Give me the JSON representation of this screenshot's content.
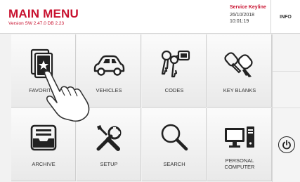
{
  "header": {
    "title": "MAIN MENU",
    "version": "Version SW 2.47.0 DB 2.23",
    "service": "Service Keyline",
    "date": "26/10/2018",
    "time": "10:01:19",
    "info_label": "INFO"
  },
  "menu": [
    {
      "label": "FAVORITES",
      "icon": "favorites-icon"
    },
    {
      "label": "VEHICLES",
      "icon": "car-icon"
    },
    {
      "label": "CODES",
      "icon": "keys-icon"
    },
    {
      "label": "KEY BLANKS",
      "icon": "key-blank-icon"
    },
    {
      "label": "ARCHIVE",
      "icon": "archive-tray-icon"
    },
    {
      "label": "SETUP",
      "icon": "tools-icon"
    },
    {
      "label": "SEARCH",
      "icon": "magnifier-icon"
    },
    {
      "label": "PERSONAL\nCOMPUTER",
      "icon": "computer-icon"
    }
  ],
  "side": {
    "power_icon": "power-icon"
  },
  "colors": {
    "accent": "#c8102e",
    "tile_bg": "#f2f2f2",
    "text": "#333333"
  },
  "cursor": {
    "icon": "hand-pointer-icon"
  }
}
